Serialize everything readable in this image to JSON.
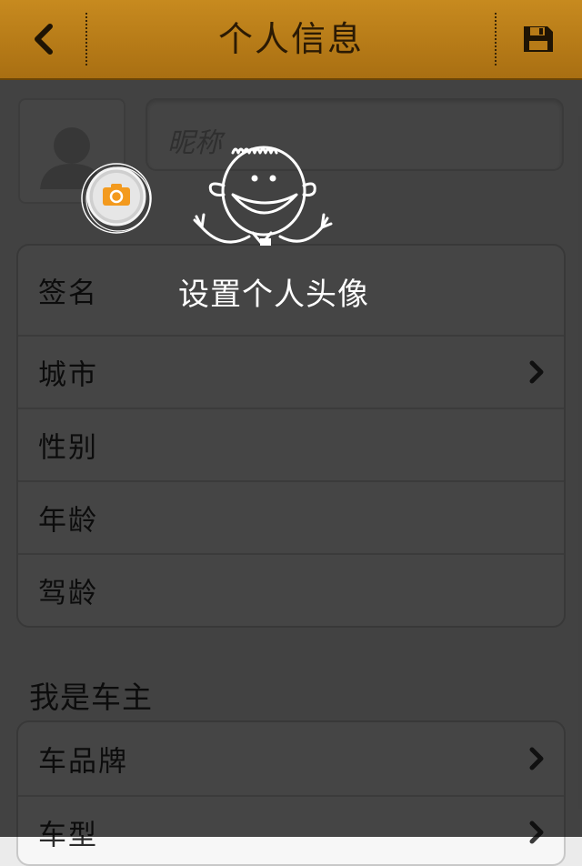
{
  "header": {
    "title": "个人信息"
  },
  "profile": {
    "nickname_placeholder": "昵称"
  },
  "info_rows": [
    {
      "label": "签名",
      "has_arrow": false
    },
    {
      "label": "城市",
      "has_arrow": true
    },
    {
      "label": "性别",
      "has_arrow": false
    },
    {
      "label": "年龄",
      "has_arrow": false
    },
    {
      "label": "驾龄",
      "has_arrow": false
    }
  ],
  "car_section": {
    "title": "我是车主",
    "rows": [
      {
        "label": "车品牌",
        "has_arrow": true
      },
      {
        "label": "车型",
        "has_arrow": true
      }
    ]
  },
  "guide": {
    "hint": "设置个人头像"
  },
  "colors": {
    "header": "#b87b17",
    "camera_accent": "#f39a1e"
  }
}
